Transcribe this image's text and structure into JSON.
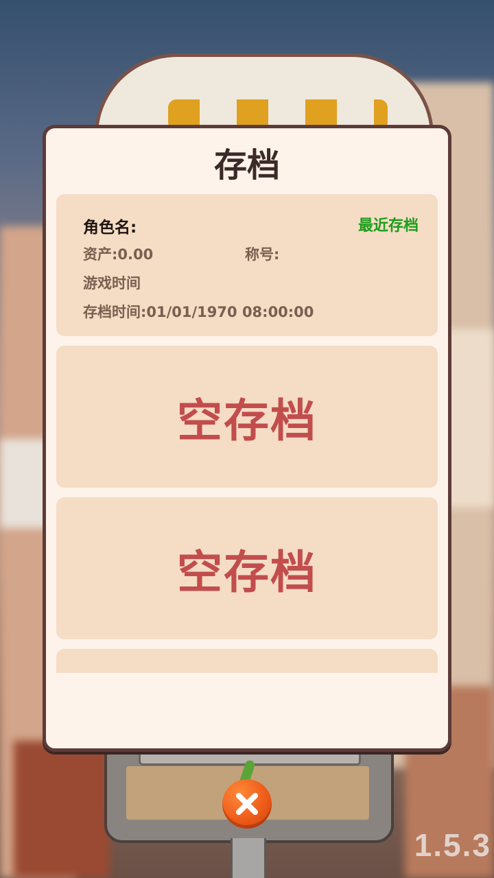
{
  "dialog": {
    "title": "存档"
  },
  "slots": {
    "first": {
      "character_name_label": "角色名:",
      "recent_tag": "最近存档",
      "assets": "资产:0.00",
      "title_label": "称号:",
      "play_time": "游戏时间",
      "save_time": "存档时间:01/01/1970  08:00:00"
    },
    "empty_label_1": "空存档",
    "empty_label_2": "空存档"
  },
  "version": "1.5.3",
  "icons": {
    "close": "close-icon"
  },
  "colors": {
    "dialog_bg": "#fdf3ea",
    "slot_bg": "#f5dcc5",
    "empty_text": "#c24d4d",
    "recent_tag": "#1a9e1a",
    "close_button": "#ee5c1a"
  }
}
